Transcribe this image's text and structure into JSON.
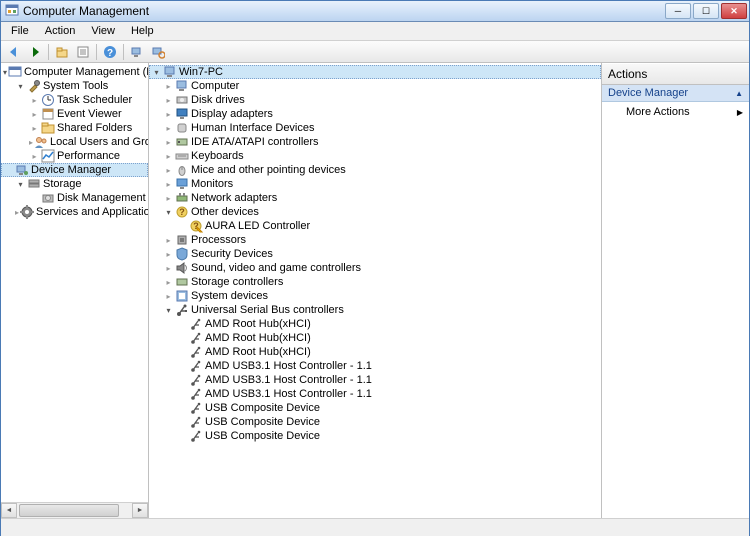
{
  "window": {
    "title": "Computer Management"
  },
  "menu": {
    "file": "File",
    "action": "Action",
    "view": "View",
    "help": "Help"
  },
  "leftTree": [
    {
      "indent": 0,
      "exp": "open",
      "icon": "mgmt",
      "label": "Computer Management (Local"
    },
    {
      "indent": 1,
      "exp": "open",
      "icon": "tools",
      "label": "System Tools"
    },
    {
      "indent": 2,
      "exp": "closed",
      "icon": "sched",
      "label": "Task Scheduler"
    },
    {
      "indent": 2,
      "exp": "closed",
      "icon": "event",
      "label": "Event Viewer"
    },
    {
      "indent": 2,
      "exp": "closed",
      "icon": "folder",
      "label": "Shared Folders"
    },
    {
      "indent": 2,
      "exp": "closed",
      "icon": "users",
      "label": "Local Users and Groups"
    },
    {
      "indent": 2,
      "exp": "closed",
      "icon": "perf",
      "label": "Performance"
    },
    {
      "indent": 2,
      "exp": "none",
      "icon": "devmgr",
      "label": "Device Manager",
      "selected": true
    },
    {
      "indent": 1,
      "exp": "open",
      "icon": "storage",
      "label": "Storage"
    },
    {
      "indent": 2,
      "exp": "none",
      "icon": "disk",
      "label": "Disk Management"
    },
    {
      "indent": 1,
      "exp": "closed",
      "icon": "services",
      "label": "Services and Applications"
    }
  ],
  "midTree": [
    {
      "indent": 0,
      "exp": "open",
      "icon": "pc",
      "label": "Win7-PC",
      "selected": true
    },
    {
      "indent": 1,
      "exp": "closed",
      "icon": "pc",
      "label": "Computer"
    },
    {
      "indent": 1,
      "exp": "closed",
      "icon": "disk2",
      "label": "Disk drives"
    },
    {
      "indent": 1,
      "exp": "closed",
      "icon": "display",
      "label": "Display adapters"
    },
    {
      "indent": 1,
      "exp": "closed",
      "icon": "hid",
      "label": "Human Interface Devices"
    },
    {
      "indent": 1,
      "exp": "closed",
      "icon": "ide",
      "label": "IDE ATA/ATAPI controllers"
    },
    {
      "indent": 1,
      "exp": "closed",
      "icon": "kbd",
      "label": "Keyboards"
    },
    {
      "indent": 1,
      "exp": "closed",
      "icon": "mouse",
      "label": "Mice and other pointing devices"
    },
    {
      "indent": 1,
      "exp": "closed",
      "icon": "monitor",
      "label": "Monitors"
    },
    {
      "indent": 1,
      "exp": "closed",
      "icon": "net",
      "label": "Network adapters"
    },
    {
      "indent": 1,
      "exp": "open",
      "icon": "other",
      "label": "Other devices"
    },
    {
      "indent": 2,
      "exp": "none",
      "icon": "warn",
      "label": "AURA LED Controller"
    },
    {
      "indent": 1,
      "exp": "closed",
      "icon": "cpu",
      "label": "Processors"
    },
    {
      "indent": 1,
      "exp": "closed",
      "icon": "sec",
      "label": "Security Devices"
    },
    {
      "indent": 1,
      "exp": "closed",
      "icon": "sound",
      "label": "Sound, video and game controllers"
    },
    {
      "indent": 1,
      "exp": "closed",
      "icon": "storage2",
      "label": "Storage controllers"
    },
    {
      "indent": 1,
      "exp": "closed",
      "icon": "sys",
      "label": "System devices"
    },
    {
      "indent": 1,
      "exp": "open",
      "icon": "usb",
      "label": "Universal Serial Bus controllers"
    },
    {
      "indent": 2,
      "exp": "none",
      "icon": "usb2",
      "label": "AMD Root Hub(xHCI)"
    },
    {
      "indent": 2,
      "exp": "none",
      "icon": "usb2",
      "label": "AMD Root Hub(xHCI)"
    },
    {
      "indent": 2,
      "exp": "none",
      "icon": "usb2",
      "label": "AMD Root Hub(xHCI)"
    },
    {
      "indent": 2,
      "exp": "none",
      "icon": "usb2",
      "label": "AMD USB3.1 Host Controller - 1.1"
    },
    {
      "indent": 2,
      "exp": "none",
      "icon": "usb2",
      "label": "AMD USB3.1 Host Controller - 1.1"
    },
    {
      "indent": 2,
      "exp": "none",
      "icon": "usb2",
      "label": "AMD USB3.1 Host Controller - 1.1"
    },
    {
      "indent": 2,
      "exp": "none",
      "icon": "usb2",
      "label": "USB Composite Device"
    },
    {
      "indent": 2,
      "exp": "none",
      "icon": "usb2",
      "label": "USB Composite Device"
    },
    {
      "indent": 2,
      "exp": "none",
      "icon": "usb2",
      "label": "USB Composite Device"
    }
  ],
  "actions": {
    "header": "Actions",
    "section": "Device Manager",
    "more": "More Actions"
  }
}
